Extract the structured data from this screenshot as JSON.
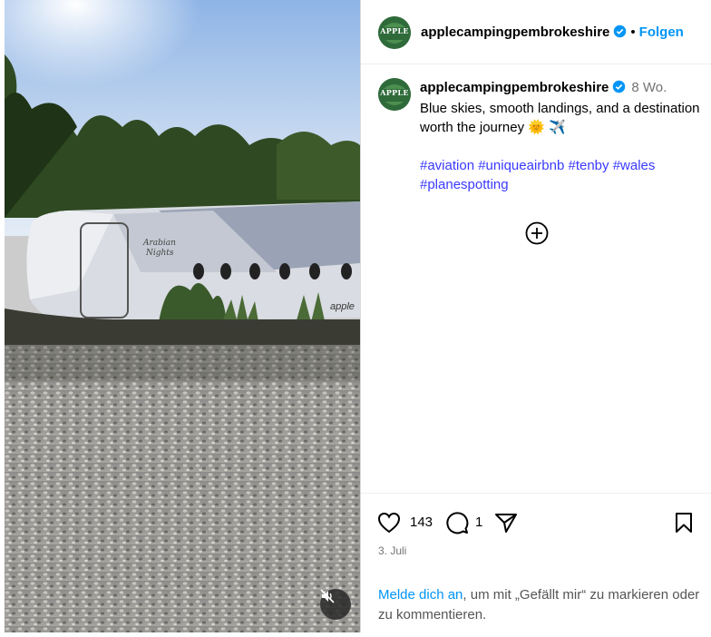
{
  "post": {
    "username": "applecampingpembrokeshire",
    "follow_label": "Folgen",
    "separator": "•",
    "age": "8 Wo.",
    "caption_text": "Blue skies, smooth landings, and a destination worth the journey 🌞 ✈️",
    "hashtags": [
      "#aviation",
      "#uniqueairbnb",
      "#tenby",
      "#wales",
      "#planespotting"
    ],
    "avatar_text": "APPLE",
    "likes": "143",
    "comments": "1",
    "date": "3. Juli",
    "login_link": "Melde dich an",
    "login_rest": ", um mit „Gefällt mir“ zu markieren oder zu kommentieren."
  },
  "media": {
    "plane_text_1": "Arabian",
    "plane_text_2": "Nights",
    "plane_side_text": "apple"
  },
  "icons": {
    "verified": "verified-badge-icon",
    "like": "heart-icon",
    "comment": "comment-icon",
    "share": "share-icon",
    "save": "bookmark-icon",
    "mute": "muted-speaker-icon",
    "add": "plus-circle-icon"
  },
  "colors": {
    "link_blue": "#0095f6",
    "hashtag": "#3a3aff",
    "secondary_text": "#737373"
  }
}
